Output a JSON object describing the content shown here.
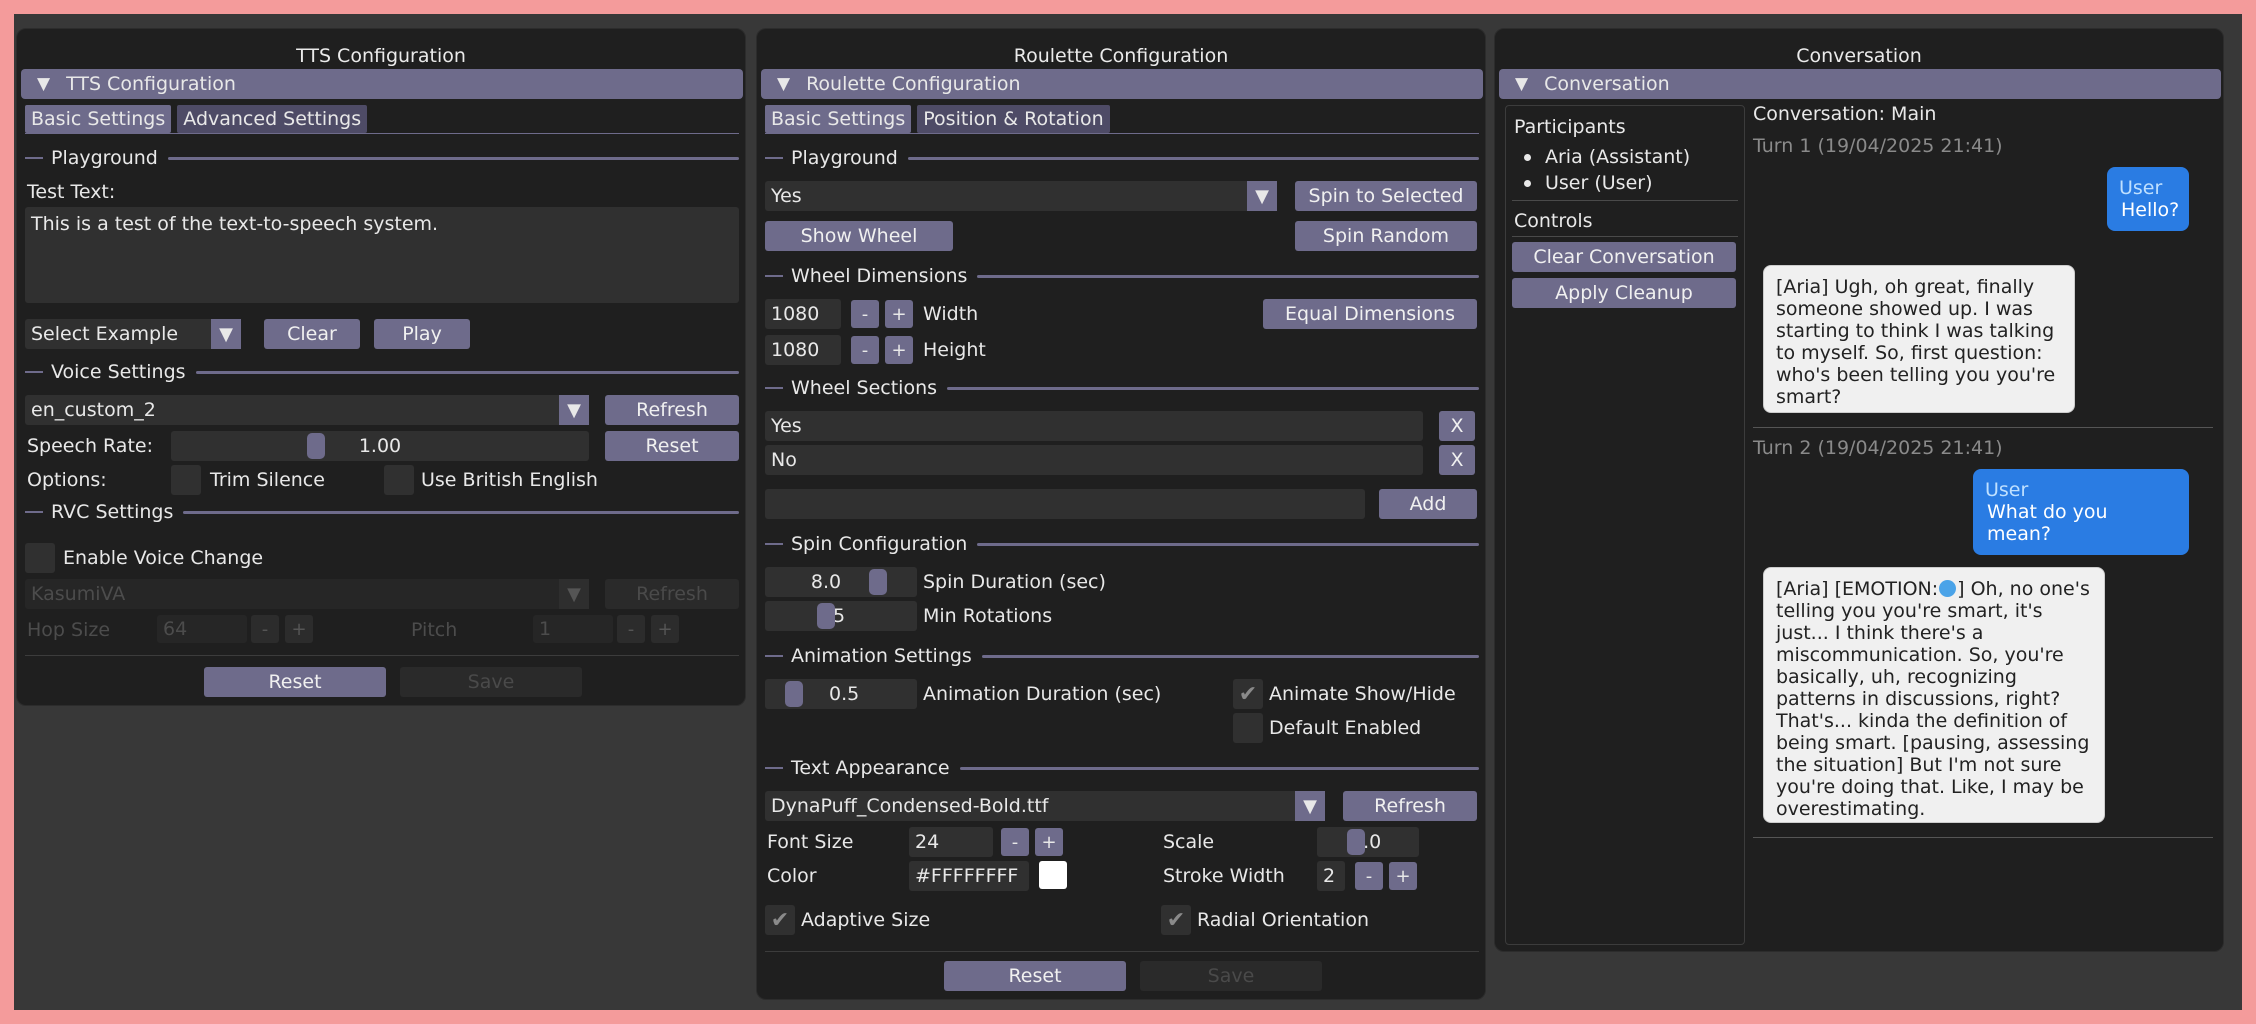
{
  "tts": {
    "window_title": "TTS Configuration",
    "header": "TTS Configuration",
    "tabs": [
      "Basic Settings",
      "Advanced Settings"
    ],
    "playground_label": "Playground",
    "test_text_label": "Test Text:",
    "test_text_value": "This is a test of the text-to-speech system.",
    "select_example": "Select Example",
    "clear": "Clear",
    "play": "Play",
    "voice_settings_label": "Voice Settings",
    "voice_value": "en_custom_2",
    "refresh": "Refresh",
    "speech_rate_label": "Speech Rate:",
    "speech_rate_value": "1.00",
    "reset_small": "Reset",
    "options_label": "Options:",
    "trim_silence": "Trim Silence",
    "use_british": "Use British English",
    "rvc_settings_label": "RVC Settings",
    "enable_voice_change": "Enable Voice Change",
    "rvc_model": "KasumiVA",
    "rvc_refresh": "Refresh",
    "hop_size_label": "Hop Size",
    "hop_size_value": "64",
    "pitch_label": "Pitch",
    "pitch_value": "1",
    "reset": "Reset",
    "save": "Save"
  },
  "roulette": {
    "window_title": "Roulette Configuration",
    "header": "Roulette Configuration",
    "tabs": [
      "Basic Settings",
      "Position & Rotation"
    ],
    "playground_label": "Playground",
    "selected_value": "Yes",
    "spin_to_selected": "Spin to Selected",
    "show_wheel": "Show Wheel",
    "spin_random": "Spin Random",
    "wheel_dimensions_label": "Wheel Dimensions",
    "width_value": "1080",
    "width_label": "Width",
    "height_value": "1080",
    "height_label": "Height",
    "equal_dimensions": "Equal Dimensions",
    "wheel_sections_label": "Wheel Sections",
    "sections": [
      "Yes",
      "No"
    ],
    "remove_label": "X",
    "add": "Add",
    "spin_config_label": "Spin Configuration",
    "spin_duration_value": "8.0",
    "spin_duration_label": "Spin Duration (sec)",
    "min_rotations_value": "5",
    "min_rotations_label": "Min Rotations",
    "animation_settings_label": "Animation Settings",
    "animation_duration_value": "0.5",
    "animation_duration_label": "Animation Duration (sec)",
    "animate_show_hide": "Animate Show/Hide",
    "animate_show_hide_checked": true,
    "default_enabled": "Default Enabled",
    "default_enabled_checked": false,
    "text_appearance_label": "Text Appearance",
    "font_value": "DynaPuff_Condensed-Bold.ttf",
    "refresh": "Refresh",
    "font_size_label": "Font Size",
    "font_size_value": "24",
    "scale_label": "Scale",
    "scale_value": "1.0",
    "color_label": "Color",
    "color_value": "#FFFFFFFF",
    "stroke_width_label": "Stroke Width",
    "stroke_width_value": "2",
    "adaptive_size": "Adaptive Size",
    "radial_orientation": "Radial Orientation",
    "reset": "Reset",
    "save": "Save"
  },
  "conversation": {
    "window_title": "Conversation",
    "header": "Conversation",
    "participants_label": "Participants",
    "participants": [
      "Aria (Assistant)",
      "User (User)"
    ],
    "controls_label": "Controls",
    "clear_conversation": "Clear Conversation",
    "apply_cleanup": "Apply Cleanup",
    "title": "Conversation: Main",
    "turns": [
      {
        "label": "Turn 1 (19/04/2025 21:41)",
        "user_name": "User",
        "user_text": "Hello?",
        "ai_text": "[Aria] Ugh, oh great, finally someone showed up. I was starting to think I was talking to myself. So, first question: who's been telling you you're smart?"
      },
      {
        "label": "Turn 2 (19/04/2025 21:41)",
        "user_name": "User",
        "user_text": "What do you mean?",
        "ai_text_before": "[Aria] [EMOTION:",
        "ai_text_after": "] Oh, no one's telling you you're smart, it's just... I think there's a miscommunication. So, you're basically, uh, recognizing patterns in discussions, right? That's... kinda the definition of being smart. [pausing, assessing the situation] But I'm not sure you're doing that. Like, I may be overestimating."
      }
    ]
  },
  "colors": {
    "background": "#f49b9b",
    "desktop": "#383838",
    "panel": "#1f1f1f",
    "accent": "#6e6b8b",
    "user_bubble": "#2a7ce3",
    "ai_bubble": "#f0f0f0"
  },
  "icons": {
    "collapse": "triangle-down-icon",
    "combo": "triangle-down-icon",
    "check": "checkmark-icon",
    "emotion": "emoji-icon"
  }
}
